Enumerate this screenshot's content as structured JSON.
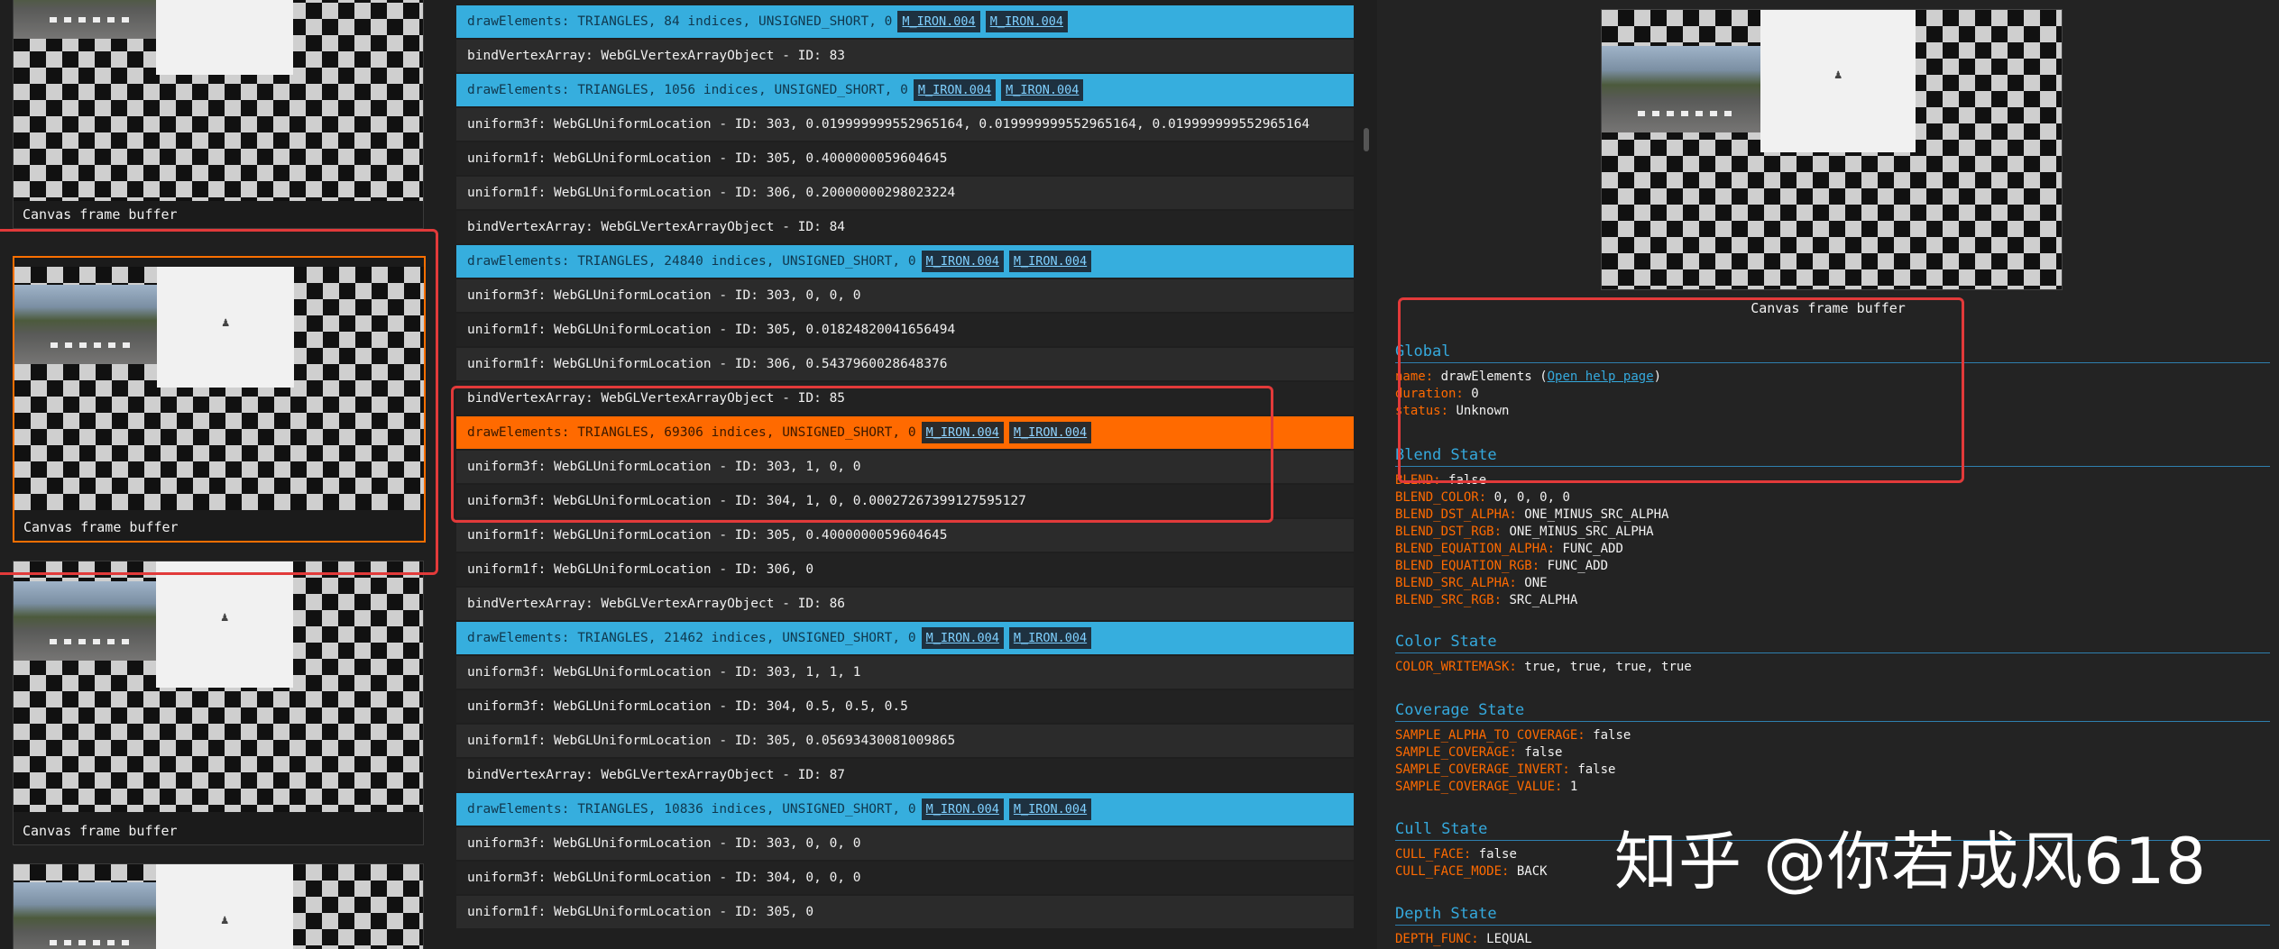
{
  "thumbnails": [
    {
      "label": "Canvas frame buffer",
      "selected": false
    },
    {
      "label": "Canvas frame buffer",
      "selected": true
    },
    {
      "label": "Canvas frame buffer",
      "selected": false
    },
    {
      "label": "",
      "selected": false
    }
  ],
  "commands": [
    {
      "type": "blue",
      "text": "drawElements: TRIANGLES, 84 indices, UNSIGNED_SHORT, 0",
      "tags": [
        "M_IRON.004",
        "M_IRON.004"
      ]
    },
    {
      "type": "dark",
      "text": "bindVertexArray: WebGLVertexArrayObject - ID: 83",
      "tags": []
    },
    {
      "type": "blue",
      "text": "drawElements: TRIANGLES, 1056 indices, UNSIGNED_SHORT, 0",
      "tags": [
        "M_IRON.004",
        "M_IRON.004"
      ]
    },
    {
      "type": "dark",
      "text": "uniform3f: WebGLUniformLocation - ID: 303, 0.019999999552965164, 0.019999999552965164, 0.019999999552965164",
      "tags": []
    },
    {
      "type": "darker",
      "text": "uniform1f: WebGLUniformLocation - ID: 305, 0.4000000059604645",
      "tags": []
    },
    {
      "type": "dark",
      "text": "uniform1f: WebGLUniformLocation - ID: 306, 0.20000000298023224",
      "tags": []
    },
    {
      "type": "darker",
      "text": "bindVertexArray: WebGLVertexArrayObject - ID: 84",
      "tags": []
    },
    {
      "type": "blue",
      "text": "drawElements: TRIANGLES, 24840 indices, UNSIGNED_SHORT, 0",
      "tags": [
        "M_IRON.004",
        "M_IRON.004"
      ]
    },
    {
      "type": "dark",
      "text": "uniform3f: WebGLUniformLocation - ID: 303, 0, 0, 0",
      "tags": []
    },
    {
      "type": "darker",
      "text": "uniform1f: WebGLUniformLocation - ID: 305, 0.01824820041656494",
      "tags": []
    },
    {
      "type": "dark",
      "text": "uniform1f: WebGLUniformLocation - ID: 306, 0.5437960028648376",
      "tags": []
    },
    {
      "type": "darker",
      "text": "bindVertexArray: WebGLVertexArrayObject - ID: 85",
      "tags": []
    },
    {
      "type": "orange",
      "text": "drawElements: TRIANGLES, 69306 indices, UNSIGNED_SHORT, 0",
      "tags": [
        "M_IRON.004",
        "M_IRON.004"
      ]
    },
    {
      "type": "dark",
      "text": "uniform3f: WebGLUniformLocation - ID: 303, 1, 0, 0",
      "tags": []
    },
    {
      "type": "darker",
      "text": "uniform3f: WebGLUniformLocation - ID: 304, 1, 0, 0.00027267399127595127",
      "tags": []
    },
    {
      "type": "dark",
      "text": "uniform1f: WebGLUniformLocation - ID: 305, 0.4000000059604645",
      "tags": []
    },
    {
      "type": "darker",
      "text": "uniform1f: WebGLUniformLocation - ID: 306, 0",
      "tags": []
    },
    {
      "type": "dark",
      "text": "bindVertexArray: WebGLVertexArrayObject - ID: 86",
      "tags": []
    },
    {
      "type": "blue",
      "text": "drawElements: TRIANGLES, 21462 indices, UNSIGNED_SHORT, 0",
      "tags": [
        "M_IRON.004",
        "M_IRON.004"
      ]
    },
    {
      "type": "dark",
      "text": "uniform3f: WebGLUniformLocation - ID: 303, 1, 1, 1",
      "tags": []
    },
    {
      "type": "darker",
      "text": "uniform3f: WebGLUniformLocation - ID: 304, 0.5, 0.5, 0.5",
      "tags": []
    },
    {
      "type": "dark",
      "text": "uniform1f: WebGLUniformLocation - ID: 305, 0.05693430081009865",
      "tags": []
    },
    {
      "type": "darker",
      "text": "bindVertexArray: WebGLVertexArrayObject - ID: 87",
      "tags": []
    },
    {
      "type": "blue",
      "text": "drawElements: TRIANGLES, 10836 indices, UNSIGNED_SHORT, 0",
      "tags": [
        "M_IRON.004",
        "M_IRON.004"
      ]
    },
    {
      "type": "dark",
      "text": "uniform3f: WebGLUniformLocation - ID: 303, 0, 0, 0",
      "tags": []
    },
    {
      "type": "darker",
      "text": "uniform3f: WebGLUniformLocation - ID: 304, 0, 0, 0",
      "tags": []
    },
    {
      "type": "dark",
      "text": "uniform1f: WebGLUniformLocation - ID: 305, 0",
      "tags": []
    }
  ],
  "inspector": {
    "preview_label": "Canvas frame buffer",
    "global": {
      "title": "Global",
      "name_key": "name:",
      "name_value": "drawElements",
      "help_link": "Open help page",
      "duration_key": "duration:",
      "duration_value": "0",
      "status_key": "status:",
      "status_value": "Unknown"
    },
    "blend": {
      "title": "Blend State",
      "items": [
        {
          "k": "BLEND:",
          "v": "false"
        },
        {
          "k": "BLEND_COLOR:",
          "v": "0, 0, 0, 0"
        },
        {
          "k": "BLEND_DST_ALPHA:",
          "v": "ONE_MINUS_SRC_ALPHA"
        },
        {
          "k": "BLEND_DST_RGB:",
          "v": "ONE_MINUS_SRC_ALPHA"
        },
        {
          "k": "BLEND_EQUATION_ALPHA:",
          "v": "FUNC_ADD"
        },
        {
          "k": "BLEND_EQUATION_RGB:",
          "v": "FUNC_ADD"
        },
        {
          "k": "BLEND_SRC_ALPHA:",
          "v": "ONE"
        },
        {
          "k": "BLEND_SRC_RGB:",
          "v": "SRC_ALPHA"
        }
      ]
    },
    "color": {
      "title": "Color State",
      "items": [
        {
          "k": "COLOR_WRITEMASK:",
          "v": "true, true, true, true"
        }
      ]
    },
    "coverage": {
      "title": "Coverage State",
      "items": [
        {
          "k": "SAMPLE_ALPHA_TO_COVERAGE:",
          "v": "false"
        },
        {
          "k": "SAMPLE_COVERAGE:",
          "v": "false"
        },
        {
          "k": "SAMPLE_COVERAGE_INVERT:",
          "v": "false"
        },
        {
          "k": "SAMPLE_COVERAGE_VALUE:",
          "v": "1"
        }
      ]
    },
    "cull": {
      "title": "Cull State",
      "items": [
        {
          "k": "CULL_FACE:",
          "v": "false"
        },
        {
          "k": "CULL_FACE_MODE:",
          "v": "BACK"
        }
      ]
    },
    "depth": {
      "title": "Depth State",
      "items": [
        {
          "k": "DEPTH_FUNC:",
          "v": "LEQUAL"
        }
      ]
    }
  },
  "watermark": "知乎 @你若成风618",
  "colors": {
    "accent_blue": "#36aede",
    "selected_orange": "#ff6a00",
    "annotation_red": "#e23a3a",
    "key_orange": "#ff6a00"
  }
}
